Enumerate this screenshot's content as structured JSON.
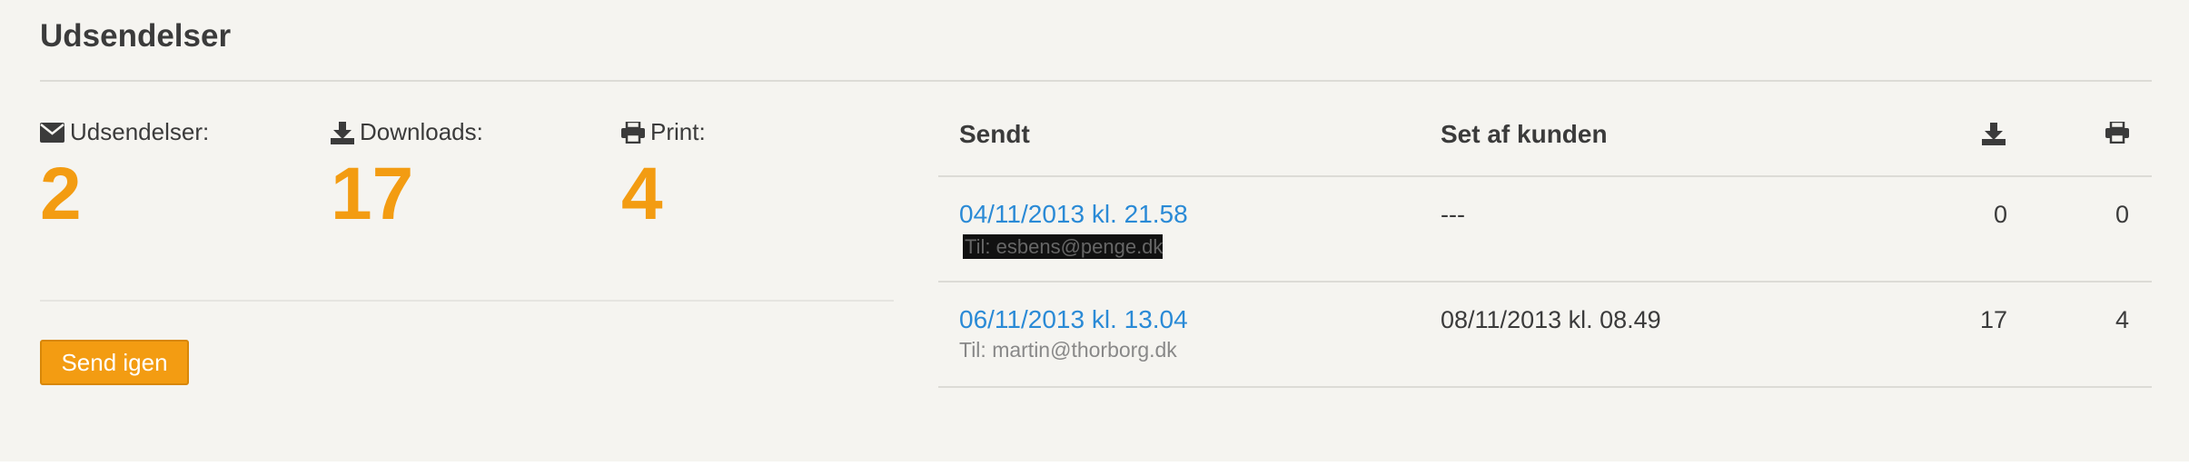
{
  "header": {
    "title": "Udsendelser"
  },
  "stats": {
    "mailings": {
      "label": "Udsendelser:",
      "value": "2",
      "icon": "envelope-icon"
    },
    "downloads": {
      "label": "Downloads:",
      "value": "17",
      "icon": "download-icon"
    },
    "prints": {
      "label": "Print:",
      "value": "4",
      "icon": "printer-icon"
    }
  },
  "actions": {
    "resend_label": "Send igen"
  },
  "table": {
    "headers": {
      "sent": "Sendt",
      "seen": "Set af kunden",
      "downloads_icon": "download-icon",
      "print_icon": "printer-icon"
    },
    "rows": [
      {
        "sent": "04/11/2013 kl. 21.58",
        "to": "Til: esbens@penge.dk",
        "seen": "---",
        "downloads": "0",
        "prints": "0"
      },
      {
        "sent": "06/11/2013 kl. 13.04",
        "to": "Til: martin@thorborg.dk",
        "seen": "08/11/2013 kl. 08.49",
        "downloads": "17",
        "prints": "4"
      }
    ]
  },
  "colors": {
    "accent": "#f39c12",
    "link": "#2a8ad6",
    "background": "#f5f4f0"
  }
}
